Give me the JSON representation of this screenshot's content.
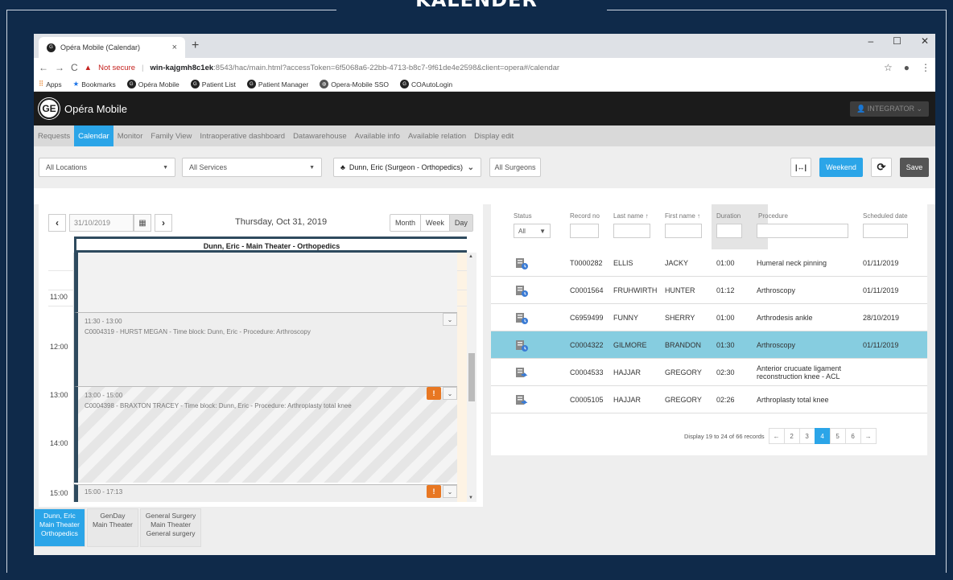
{
  "slide_title": "KALENDER",
  "browser": {
    "tab_title": "Opéra Mobile (Calendar)",
    "tab_close": "×",
    "new_tab": "+",
    "win_min": "–",
    "win_max": "☐",
    "win_close": "✕",
    "not_secure": "Not secure",
    "url_host": "win-kajgmh8c1ek",
    "url_rest": ":8543/hac/main.html?accessToken=6f5068a6-22bb-4713-b8c7-9f61de4e2598&client=opera#/calendar",
    "bookmarks": [
      "Apps",
      "Bookmarks",
      "Opéra Mobile",
      "Patient List",
      "Patient Manager",
      "Opera-Mobile SSO",
      "COAutoLogin"
    ]
  },
  "app": {
    "logo": "GE",
    "name": "Opéra Mobile",
    "user": "INTEGRATOR"
  },
  "menu": [
    "Requests",
    "Calendar",
    "Monitor",
    "Family View",
    "Intraoperative dashboard",
    "Datawarehouse",
    "Available info",
    "Available relation",
    "Display edit"
  ],
  "filters": {
    "locations": "All Locations",
    "services": "All Services",
    "surgeon": "Dunn, Eric (Surgeon - Orthopedics)",
    "all_surgeons": "All Surgeons",
    "weekend": "Weekend",
    "save": "Save"
  },
  "calendar": {
    "date": "31/10/2019",
    "day_label": "Thursday, Oct 31, 2019",
    "views": [
      "Month",
      "Week",
      "Day"
    ],
    "column_title": "Dunn, Eric - Main Theater - Orthopedics",
    "times": [
      "11:00",
      "12:00",
      "13:00",
      "14:00",
      "15:00"
    ],
    "events": [
      {
        "time": "11:30 - 13:00",
        "desc": "C0004319 - HURST MEGAN - Time block: Dunn, Eric - Procedure: Arthroscopy"
      },
      {
        "time": "13:00 - 15:00",
        "desc": "C0004398 - BRAXTON TRACEY - Time block: Dunn, Eric - Procedure: Arthroplasty total knee"
      },
      {
        "time": "15:00 - 17:13",
        "desc": ""
      }
    ],
    "alert_glyph": "!",
    "chevron_glyph": "⌄"
  },
  "resources": [
    {
      "l1": "Dunn, Eric",
      "l2": "Main Theater",
      "l3": "Orthopedics",
      "active": true
    },
    {
      "l1": "GenDay",
      "l2": "Main Theater",
      "l3": "",
      "active": false
    },
    {
      "l1": "General Surgery",
      "l2": "Main Theater",
      "l3": "General surgery",
      "active": false
    }
  ],
  "list": {
    "headers": {
      "status": "Status",
      "record": "Record no",
      "last": "Last name",
      "first": "First name",
      "duration": "Duration",
      "procedure": "Procedure",
      "scheduled": "Scheduled date"
    },
    "status_filter": "All",
    "sort_arrow": "↑",
    "rows": [
      {
        "icon": "clock",
        "record": "T0000282",
        "last": "ELLIS",
        "first": "JACKY",
        "duration": "01:00",
        "procedure": "Humeral neck pinning",
        "date": "01/11/2019"
      },
      {
        "icon": "clock",
        "record": "C0001564",
        "last": "FRUHWIRTH",
        "first": "HUNTER",
        "duration": "01:12",
        "procedure": "Arthroscopy",
        "date": "01/11/2019"
      },
      {
        "icon": "clock",
        "record": "C6959499",
        "last": "FUNNY",
        "first": "SHERRY",
        "duration": "01:00",
        "procedure": "Arthrodesis ankle",
        "date": "28/10/2019"
      },
      {
        "icon": "clock",
        "record": "C0004322",
        "last": "GILMORE",
        "first": "BRANDON",
        "duration": "01:30",
        "procedure": "Arthroscopy",
        "date": "01/11/2019"
      },
      {
        "icon": "arrow",
        "record": "C0004533",
        "last": "HAJJAR",
        "first": "GREGORY",
        "duration": "02:30",
        "procedure": "Anterior crucuate ligament reconstruction knee - ACL",
        "date": ""
      },
      {
        "icon": "arrow",
        "record": "C0005105",
        "last": "HAJJAR",
        "first": "GREGORY",
        "duration": "02:26",
        "procedure": "Arthroplasty total knee",
        "date": ""
      }
    ],
    "pager_info": "Display 19 to 24 of 66 records",
    "pages": [
      "←",
      "2",
      "3",
      "4",
      "5",
      "6",
      "→"
    ]
  },
  "colors": {
    "accent": "#2ba5e8",
    "selected_row": "#86cde0",
    "dark_header": "#1b1b1b",
    "alert": "#e87722",
    "slide_bg": "#0f2a4a"
  }
}
